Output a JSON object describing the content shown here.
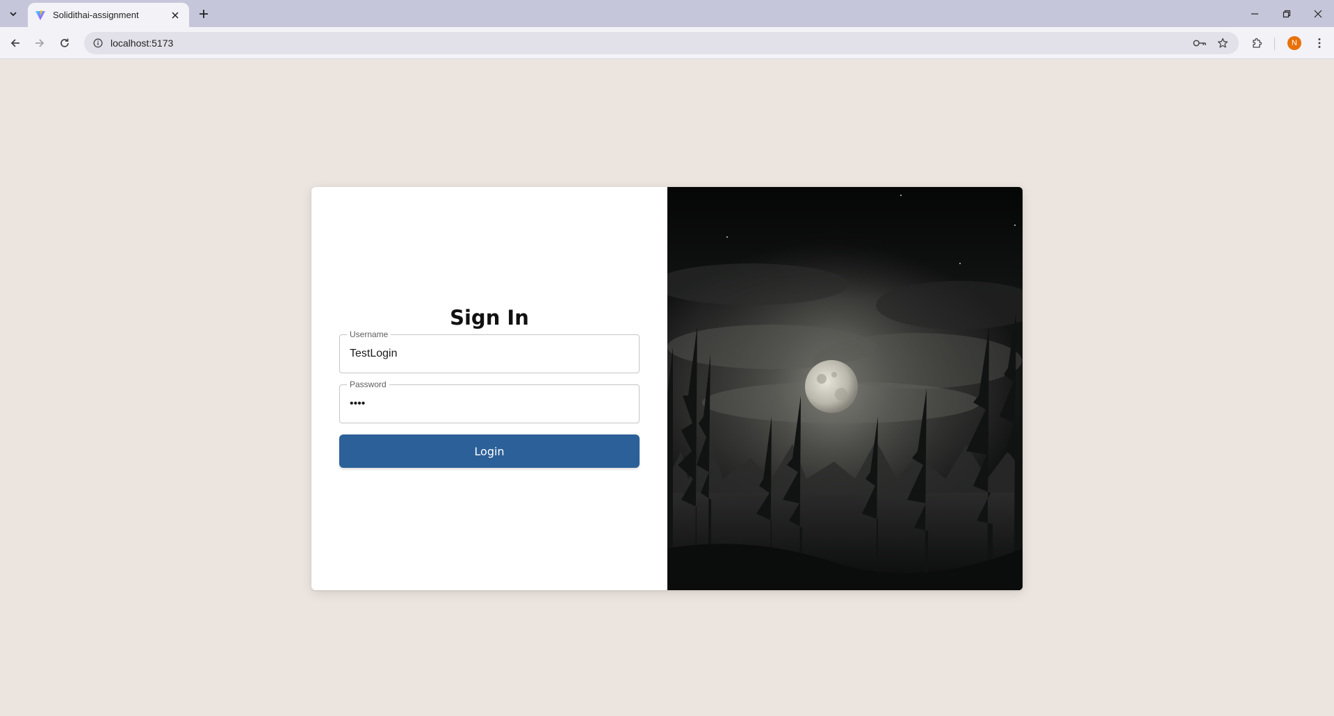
{
  "browser": {
    "tab_title": "Solidithai-assignment",
    "url": "localhost:5173",
    "profile_initial": "N",
    "icons": {
      "tab_search": "chevron-down-icon",
      "favicon": "vite-logo-icon",
      "tab_close": "close-icon",
      "new_tab": "plus-icon",
      "back": "arrow-left-icon",
      "forward": "arrow-right-icon",
      "reload": "reload-icon",
      "site_info": "info-icon",
      "password": "key-icon",
      "bookmark": "star-icon",
      "extensions": "puzzle-icon",
      "menu": "kebab-menu-icon",
      "minimize": "minimize-icon",
      "restore": "restore-icon",
      "close_window": "close-icon"
    }
  },
  "login": {
    "heading": "Sign In",
    "username_label": "Username",
    "username_value": "TestLogin",
    "password_label": "Password",
    "password_value": "••••",
    "button_label": "Login"
  },
  "colors": {
    "page_background": "#ebe4df",
    "button": "#2c6098",
    "avatar": "#e8710a"
  }
}
